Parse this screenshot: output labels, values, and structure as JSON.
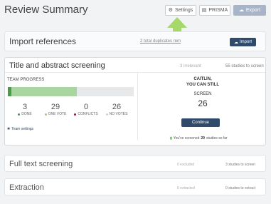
{
  "header": {
    "title": "Review Summary",
    "buttons": {
      "settings": "Settings",
      "prisma": "PRISMA",
      "export": "Export"
    }
  },
  "import": {
    "title": "Import references",
    "duplicates_link": "2 total duplicates rem",
    "import_button": "Import"
  },
  "title_abstract": {
    "title": "Title and abstract screening",
    "irrelevant": "3 irrelevant",
    "to_screen": "55 studies to screen",
    "team_progress_label": "TEAM PROGRESS",
    "progress": {
      "done_fraction": 0.03,
      "partial_fraction": 0.55
    },
    "stats": [
      {
        "value": "3",
        "label": "DONE",
        "color": "#4a9a4a"
      },
      {
        "value": "29",
        "label": "ONE VOTE",
        "color": "#c2b88a"
      },
      {
        "value": "0",
        "label": "CONFLICTS",
        "color": "#8a1c3a"
      },
      {
        "value": "26",
        "label": "NO VOTES",
        "color": "#cfd3d8"
      }
    ],
    "team_settings": "Team settings",
    "cta_name": "CAITLIN,",
    "cta_line2": "YOU CAN STILL",
    "cta_screen": "SCREEN",
    "cta_count": "26",
    "continue_button": "Continue",
    "screened_prefix": "You've screened",
    "screened_count": "29",
    "screened_suffix": "studies so far"
  },
  "full_text": {
    "title": "Full text screening",
    "excluded": "0 excluded",
    "to_screen": "3 studies to screen"
  },
  "extraction": {
    "title": "Extraction",
    "extracted": "0 extracted",
    "to_extract": "0 studies to extract"
  },
  "colors": {
    "primary": "#2f4a6b",
    "progress_done": "#4a9a4a",
    "progress_partial": "#a8d5a0",
    "arrow": "#a6d86a"
  },
  "icons": [
    "gear-icon",
    "prisma-icon",
    "export-cloud-icon",
    "import-cloud-icon",
    "arrow-up-icon",
    "team-settings-icon",
    "chart-icon"
  ]
}
